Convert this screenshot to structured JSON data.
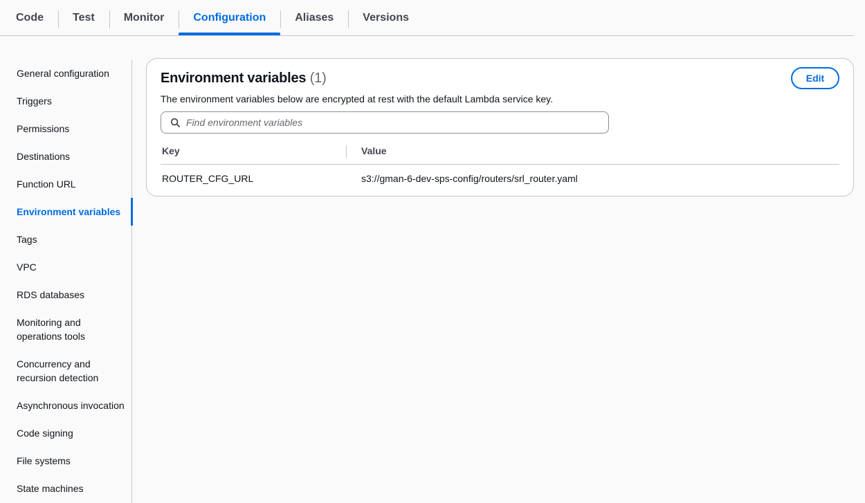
{
  "tabs": [
    {
      "label": "Code"
    },
    {
      "label": "Test"
    },
    {
      "label": "Monitor"
    },
    {
      "label": "Configuration",
      "active": true
    },
    {
      "label": "Aliases"
    },
    {
      "label": "Versions"
    }
  ],
  "sidebar": {
    "items": [
      {
        "label": "General configuration"
      },
      {
        "label": "Triggers"
      },
      {
        "label": "Permissions"
      },
      {
        "label": "Destinations"
      },
      {
        "label": "Function URL"
      },
      {
        "label": "Environment variables",
        "active": true
      },
      {
        "label": "Tags"
      },
      {
        "label": "VPC"
      },
      {
        "label": "RDS databases"
      },
      {
        "label": "Monitoring and operations tools"
      },
      {
        "label": "Concurrency and recursion detection"
      },
      {
        "label": "Asynchronous invocation"
      },
      {
        "label": "Code signing"
      },
      {
        "label": "File systems"
      },
      {
        "label": "State machines"
      }
    ]
  },
  "panel": {
    "title": "Environment variables",
    "count": "(1)",
    "description": "The environment variables below are encrypted at rest with the default Lambda service key.",
    "edit_label": "Edit",
    "search_placeholder": "Find environment variables",
    "search_value": "",
    "columns": {
      "key": "Key",
      "value": "Value"
    },
    "rows": [
      {
        "key": "ROUTER_CFG_URL",
        "value": "s3://gman-6-dev-sps-config/routers/srl_router.yaml"
      }
    ]
  },
  "colors": {
    "accent": "#006ce0",
    "border": "#c6c6cd",
    "background": "#fafafa"
  }
}
